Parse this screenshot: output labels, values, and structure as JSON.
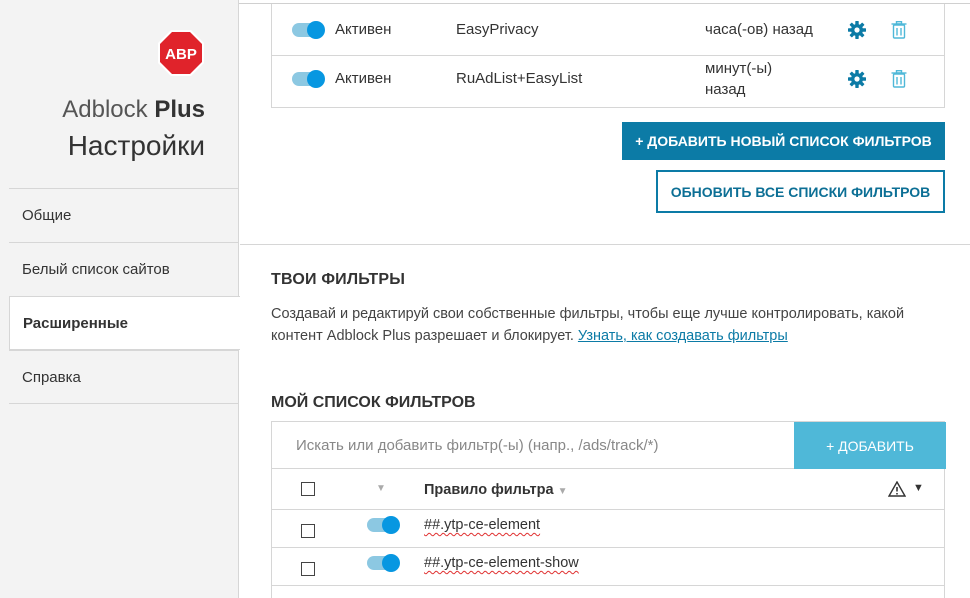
{
  "sidebar": {
    "logo_text": "ABP",
    "brand_light": "Adblock",
    "brand_bold": "Plus",
    "title": "Настройки",
    "items": [
      {
        "label": "Общие"
      },
      {
        "label": "Белый список сайтов"
      },
      {
        "label": "Расширенные"
      },
      {
        "label": "Справка"
      }
    ]
  },
  "subscriptions": [
    {
      "status": "Активен",
      "name": "EasyPrivacy",
      "updated": "часа(-ов) назад"
    },
    {
      "status": "Активен",
      "name": "RuAdList+EasyList",
      "updated": "минут(-ы) назад"
    }
  ],
  "buttons": {
    "add_list": "+ ДОБАВИТЬ НОВЫЙ СПИСОК ФИЛЬТРОВ",
    "update_all": "ОБНОВИТЬ ВСЕ СПИСКИ ФИЛЬТРОВ"
  },
  "my_filters": {
    "heading": "ТВОИ ФИЛЬТРЫ",
    "description": "Создавай и редактируй свои собственные фильтры, чтобы еще лучше контролировать, какой контент Adblock Plus разрешает и блокирует. ",
    "link": "Узнать, как создавать фильтры"
  },
  "filter_list": {
    "heading": "МОЙ СПИСОК ФИЛЬТРОВ",
    "search_placeholder": "Искать или добавить фильтр(-ы) (напр., /ads/track/*)",
    "add_button": "+ ДОБАВИТЬ",
    "column_rule": "Правило фильтра",
    "rows": [
      {
        "rule": "##.ytp-ce-element",
        "enabled": true
      },
      {
        "rule": "##.ytp-ce-element-show",
        "enabled": true
      }
    ]
  },
  "colors": {
    "accent": "#0c7ba6",
    "toggle_on": "#0797e1",
    "add_button": "#4fb8d8"
  }
}
